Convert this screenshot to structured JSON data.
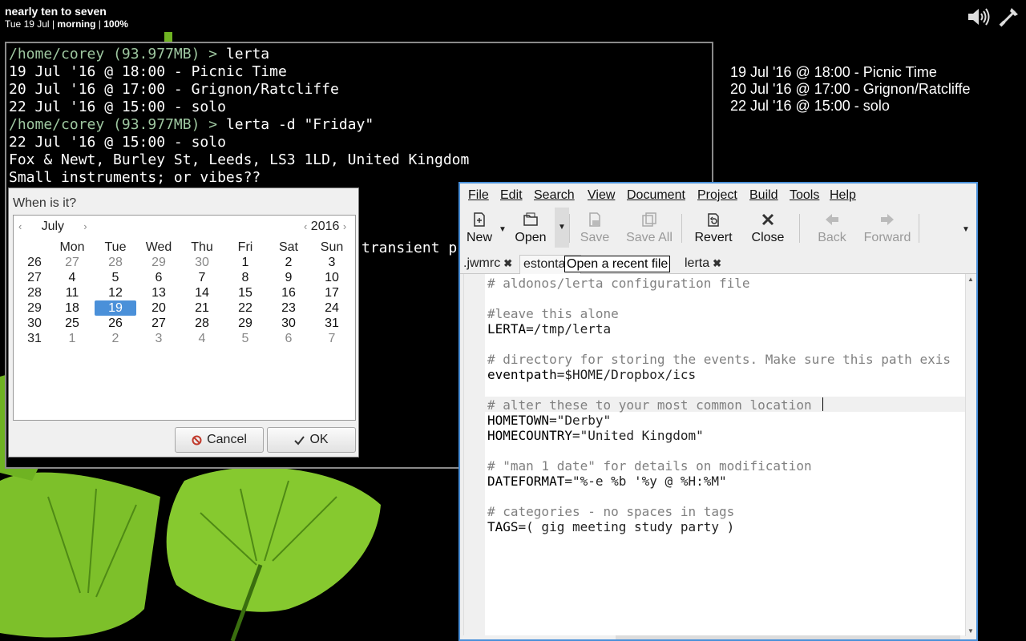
{
  "topbar": {
    "clock_title": "nearly ten to seven",
    "date": "Tue 19 Jul",
    "period": "morning",
    "battery": "100%",
    "separator": "|"
  },
  "desktop_events": [
    "19 Jul '16 @ 18:00 - Picnic Time",
    "20 Jul '16 @ 17:00 - Grignon/Ratcliffe",
    "22 Jul '16 @ 15:00 - solo"
  ],
  "terminal": {
    "lines": [
      {
        "prompt": "/home/corey (93.977MB) > ",
        "cmd": "lerta"
      },
      {
        "text": "19 Jul '16 @ 18:00 - Picnic Time"
      },
      {
        "text": "20 Jul '16 @ 17:00 - Grignon/Ratcliffe"
      },
      {
        "text": "22 Jul '16 @ 15:00 - solo"
      },
      {
        "prompt": "/home/corey (93.977MB) > ",
        "cmd": "lerta -d \"Friday\""
      },
      {
        "text": "22 Jul '16 @ 15:00 - solo"
      },
      {
        "text": "Fox & Newt, Burley St, Leeds, LS3 1LD, United Kingdom"
      },
      {
        "text": "Small instruments; or vibes??"
      }
    ],
    "partial_text": "transient p"
  },
  "calendar_dialog": {
    "title": "When is it?",
    "month": "July",
    "year": "2016",
    "prev_arrow": "‹",
    "next_arrow": "›",
    "weekdays": [
      "Mon",
      "Tue",
      "Wed",
      "Thu",
      "Fri",
      "Sat",
      "Sun"
    ],
    "weeks": [
      {
        "num": "26",
        "days": [
          [
            "27",
            0
          ],
          [
            "28",
            0
          ],
          [
            "29",
            0
          ],
          [
            "30",
            0
          ],
          [
            "1",
            1
          ],
          [
            "2",
            1
          ],
          [
            "3",
            1
          ]
        ]
      },
      {
        "num": "27",
        "days": [
          [
            "4",
            1
          ],
          [
            "5",
            1
          ],
          [
            "6",
            1
          ],
          [
            "7",
            1
          ],
          [
            "8",
            1
          ],
          [
            "9",
            1
          ],
          [
            "10",
            1
          ]
        ]
      },
      {
        "num": "28",
        "days": [
          [
            "11",
            1
          ],
          [
            "12",
            1
          ],
          [
            "13",
            1
          ],
          [
            "14",
            1
          ],
          [
            "15",
            1
          ],
          [
            "16",
            1
          ],
          [
            "17",
            1
          ]
        ]
      },
      {
        "num": "29",
        "days": [
          [
            "18",
            1
          ],
          [
            "19",
            1
          ],
          [
            "20",
            1
          ],
          [
            "21",
            1
          ],
          [
            "22",
            1
          ],
          [
            "23",
            1
          ],
          [
            "24",
            1
          ]
        ]
      },
      {
        "num": "30",
        "days": [
          [
            "25",
            1
          ],
          [
            "26",
            1
          ],
          [
            "27",
            1
          ],
          [
            "28",
            1
          ],
          [
            "29",
            1
          ],
          [
            "30",
            1
          ],
          [
            "31",
            1
          ]
        ]
      },
      {
        "num": "31",
        "days": [
          [
            "1",
            0
          ],
          [
            "2",
            0
          ],
          [
            "3",
            0
          ],
          [
            "4",
            0
          ],
          [
            "5",
            0
          ],
          [
            "6",
            0
          ],
          [
            "7",
            0
          ]
        ]
      }
    ],
    "selected_day": "19",
    "cancel_label": "Cancel",
    "ok_label": "OK"
  },
  "editor": {
    "menu": [
      "File",
      "Edit",
      "Search",
      "View",
      "Document",
      "Project",
      "Build",
      "Tools",
      "Help"
    ],
    "toolbar": {
      "new": "New",
      "open": "Open",
      "save": "Save",
      "save_all": "Save All",
      "revert": "Revert",
      "close": "Close",
      "back": "Back",
      "forward": "Forward"
    },
    "tabs": [
      {
        "label": ".jwmrc"
      },
      {
        "label": "estonta"
      },
      {
        "label": "lerta"
      }
    ],
    "tooltip": "Open a recent file",
    "code_lines": [
      {
        "t": "comment",
        "text": "# aldonos/lerta configuration file"
      },
      {
        "t": "blank",
        "text": ""
      },
      {
        "t": "comment",
        "text": "#leave this alone"
      },
      {
        "t": "assign",
        "key": "LERTA",
        "val": "=/tmp/lerta"
      },
      {
        "t": "blank",
        "text": ""
      },
      {
        "t": "comment",
        "text": "# directory for storing the events. Make sure this path exis"
      },
      {
        "t": "assign",
        "key": "eventpath",
        "val": "=$HOME/Dropbox/ics"
      },
      {
        "t": "blank",
        "text": ""
      },
      {
        "t": "comment",
        "text": "# alter these to your most common location"
      },
      {
        "t": "assign",
        "key": "HOMETOWN",
        "val": "=\"Derby\""
      },
      {
        "t": "assign",
        "key": "HOMECOUNTRY",
        "val": "=\"United Kingdom\""
      },
      {
        "t": "blank",
        "text": ""
      },
      {
        "t": "comment",
        "text": "# \"man 1 date\" for details on modification"
      },
      {
        "t": "assign",
        "key": "DATEFORMAT",
        "val": "=\"%-e %b '%y @ %H:%M\""
      },
      {
        "t": "blank",
        "text": ""
      },
      {
        "t": "comment",
        "text": "# categories - no spaces in tags"
      },
      {
        "t": "assign",
        "key": "TAGS",
        "val": "=( gig meeting study party )"
      }
    ]
  }
}
